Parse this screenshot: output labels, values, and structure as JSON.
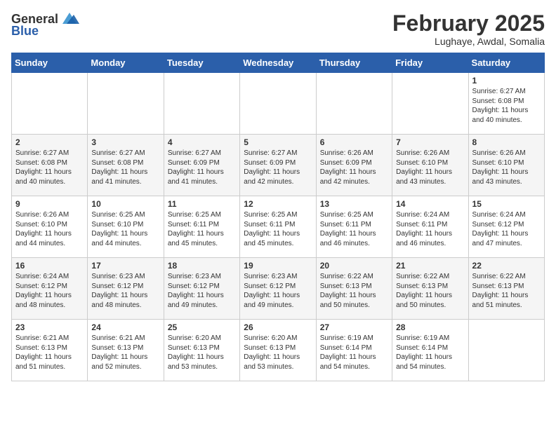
{
  "header": {
    "logo": {
      "general": "General",
      "blue": "Blue"
    },
    "title": "February 2025",
    "location": "Lughaye, Awdal, Somalia"
  },
  "calendar": {
    "days_of_week": [
      "Sunday",
      "Monday",
      "Tuesday",
      "Wednesday",
      "Thursday",
      "Friday",
      "Saturday"
    ],
    "weeks": [
      {
        "shaded": false,
        "days": [
          {
            "num": "",
            "info": ""
          },
          {
            "num": "",
            "info": ""
          },
          {
            "num": "",
            "info": ""
          },
          {
            "num": "",
            "info": ""
          },
          {
            "num": "",
            "info": ""
          },
          {
            "num": "",
            "info": ""
          },
          {
            "num": "1",
            "info": "Sunrise: 6:27 AM\nSunset: 6:08 PM\nDaylight: 11 hours\nand 40 minutes."
          }
        ]
      },
      {
        "shaded": true,
        "days": [
          {
            "num": "2",
            "info": "Sunrise: 6:27 AM\nSunset: 6:08 PM\nDaylight: 11 hours\nand 40 minutes."
          },
          {
            "num": "3",
            "info": "Sunrise: 6:27 AM\nSunset: 6:08 PM\nDaylight: 11 hours\nand 41 minutes."
          },
          {
            "num": "4",
            "info": "Sunrise: 6:27 AM\nSunset: 6:09 PM\nDaylight: 11 hours\nand 41 minutes."
          },
          {
            "num": "5",
            "info": "Sunrise: 6:27 AM\nSunset: 6:09 PM\nDaylight: 11 hours\nand 42 minutes."
          },
          {
            "num": "6",
            "info": "Sunrise: 6:26 AM\nSunset: 6:09 PM\nDaylight: 11 hours\nand 42 minutes."
          },
          {
            "num": "7",
            "info": "Sunrise: 6:26 AM\nSunset: 6:10 PM\nDaylight: 11 hours\nand 43 minutes."
          },
          {
            "num": "8",
            "info": "Sunrise: 6:26 AM\nSunset: 6:10 PM\nDaylight: 11 hours\nand 43 minutes."
          }
        ]
      },
      {
        "shaded": false,
        "days": [
          {
            "num": "9",
            "info": "Sunrise: 6:26 AM\nSunset: 6:10 PM\nDaylight: 11 hours\nand 44 minutes."
          },
          {
            "num": "10",
            "info": "Sunrise: 6:25 AM\nSunset: 6:10 PM\nDaylight: 11 hours\nand 44 minutes."
          },
          {
            "num": "11",
            "info": "Sunrise: 6:25 AM\nSunset: 6:11 PM\nDaylight: 11 hours\nand 45 minutes."
          },
          {
            "num": "12",
            "info": "Sunrise: 6:25 AM\nSunset: 6:11 PM\nDaylight: 11 hours\nand 45 minutes."
          },
          {
            "num": "13",
            "info": "Sunrise: 6:25 AM\nSunset: 6:11 PM\nDaylight: 11 hours\nand 46 minutes."
          },
          {
            "num": "14",
            "info": "Sunrise: 6:24 AM\nSunset: 6:11 PM\nDaylight: 11 hours\nand 46 minutes."
          },
          {
            "num": "15",
            "info": "Sunrise: 6:24 AM\nSunset: 6:12 PM\nDaylight: 11 hours\nand 47 minutes."
          }
        ]
      },
      {
        "shaded": true,
        "days": [
          {
            "num": "16",
            "info": "Sunrise: 6:24 AM\nSunset: 6:12 PM\nDaylight: 11 hours\nand 48 minutes."
          },
          {
            "num": "17",
            "info": "Sunrise: 6:23 AM\nSunset: 6:12 PM\nDaylight: 11 hours\nand 48 minutes."
          },
          {
            "num": "18",
            "info": "Sunrise: 6:23 AM\nSunset: 6:12 PM\nDaylight: 11 hours\nand 49 minutes."
          },
          {
            "num": "19",
            "info": "Sunrise: 6:23 AM\nSunset: 6:12 PM\nDaylight: 11 hours\nand 49 minutes."
          },
          {
            "num": "20",
            "info": "Sunrise: 6:22 AM\nSunset: 6:13 PM\nDaylight: 11 hours\nand 50 minutes."
          },
          {
            "num": "21",
            "info": "Sunrise: 6:22 AM\nSunset: 6:13 PM\nDaylight: 11 hours\nand 50 minutes."
          },
          {
            "num": "22",
            "info": "Sunrise: 6:22 AM\nSunset: 6:13 PM\nDaylight: 11 hours\nand 51 minutes."
          }
        ]
      },
      {
        "shaded": false,
        "days": [
          {
            "num": "23",
            "info": "Sunrise: 6:21 AM\nSunset: 6:13 PM\nDaylight: 11 hours\nand 51 minutes."
          },
          {
            "num": "24",
            "info": "Sunrise: 6:21 AM\nSunset: 6:13 PM\nDaylight: 11 hours\nand 52 minutes."
          },
          {
            "num": "25",
            "info": "Sunrise: 6:20 AM\nSunset: 6:13 PM\nDaylight: 11 hours\nand 53 minutes."
          },
          {
            "num": "26",
            "info": "Sunrise: 6:20 AM\nSunset: 6:13 PM\nDaylight: 11 hours\nand 53 minutes."
          },
          {
            "num": "27",
            "info": "Sunrise: 6:19 AM\nSunset: 6:14 PM\nDaylight: 11 hours\nand 54 minutes."
          },
          {
            "num": "28",
            "info": "Sunrise: 6:19 AM\nSunset: 6:14 PM\nDaylight: 11 hours\nand 54 minutes."
          },
          {
            "num": "",
            "info": ""
          }
        ]
      }
    ]
  }
}
